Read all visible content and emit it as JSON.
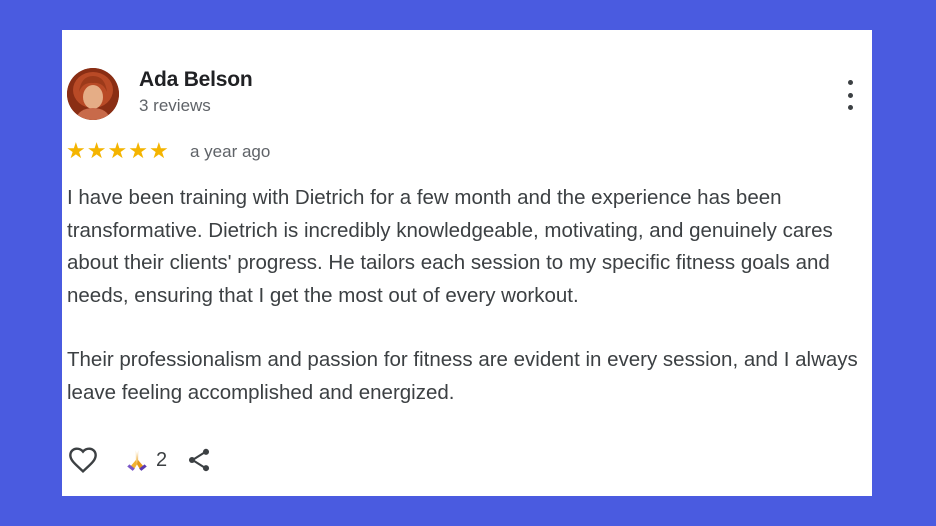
{
  "review": {
    "author": "Ada Belson",
    "author_meta": "3 reviews",
    "rating": 5,
    "time": "a year ago",
    "paragraphs": [
      "I have been training with Dietrich for a few month and the experience has been transformative. Dietrich is incredibly knowledgeable, motivating, and genuinely cares about their clients' progress. He tailors each session to my specific fitness goals and needs, ensuring that I get the most out of every workout.",
      "Their professionalism and passion for fitness are evident in every session, and I always leave feeling accomplished and energized."
    ],
    "reaction_count": "2"
  },
  "icons": {
    "star": "★",
    "more": "more-vert-icon",
    "heart": "heart-outline-icon",
    "reaction": "praying-hands-icon",
    "share": "share-icon"
  },
  "colors": {
    "background": "#4a5be0",
    "star": "#f4b400",
    "text": "#3c4043",
    "muted": "#5f6368"
  }
}
